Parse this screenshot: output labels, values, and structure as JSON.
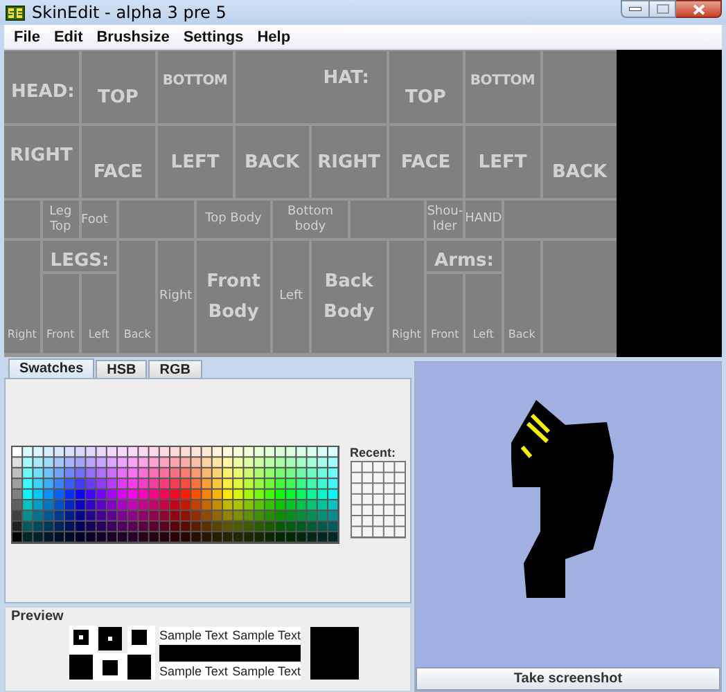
{
  "window": {
    "title": "SkinEdit - alpha 3 pre 5"
  },
  "menu": [
    "File",
    "Edit",
    "Brushsize",
    "Settings",
    "Help"
  ],
  "template": {
    "regions": [
      {
        "kind": "label",
        "label": "HEAD:"
      },
      {
        "kind": "label",
        "label": "TOP"
      },
      {
        "kind": "label",
        "label": "BOTTOM"
      },
      {
        "kind": "label",
        "label": "HAT:"
      },
      {
        "kind": "label",
        "label": "TOP"
      },
      {
        "kind": "label",
        "label": "BOTTOM"
      },
      {
        "kind": "empty"
      },
      {
        "kind": "label",
        "label": "RIGHT"
      },
      {
        "kind": "label",
        "label": "FACE"
      },
      {
        "kind": "label",
        "label": "LEFT"
      },
      {
        "kind": "label",
        "label": "BACK"
      },
      {
        "kind": "label",
        "label": "RIGHT"
      },
      {
        "kind": "label",
        "label": "FACE"
      },
      {
        "kind": "label",
        "label": "LEFT"
      },
      {
        "kind": "label",
        "label": "BACK"
      },
      {
        "kind": "empty"
      },
      {
        "kind": "label",
        "label": "Leg Top"
      },
      {
        "kind": "label",
        "label": "Foot"
      },
      {
        "kind": "empty"
      },
      {
        "kind": "label",
        "label": "Top Body"
      },
      {
        "kind": "label",
        "label": "Bottom body"
      },
      {
        "kind": "empty"
      },
      {
        "kind": "label",
        "label": "Shou-lder"
      },
      {
        "kind": "label",
        "label": "HAND"
      },
      {
        "kind": "empty"
      },
      {
        "kind": "label",
        "label": "Right"
      },
      {
        "kind": "label",
        "label": "Front"
      },
      {
        "kind": "label",
        "label": "Left"
      },
      {
        "kind": "label",
        "label": "Back"
      },
      {
        "kind": "label",
        "label": "Right"
      },
      {
        "kind": "label",
        "label": "Front Body"
      },
      {
        "kind": "label",
        "label": "Left"
      },
      {
        "kind": "label",
        "label": "Back Body"
      },
      {
        "kind": "label",
        "label": "Right"
      },
      {
        "kind": "label",
        "label": "Front"
      },
      {
        "kind": "label",
        "label": "Left"
      },
      {
        "kind": "label",
        "label": "Back"
      },
      {
        "kind": "empty"
      }
    ],
    "section_labels": [
      "LEGS:",
      "Arms:"
    ]
  },
  "color_chooser": {
    "tabs": [
      {
        "label": "Swatches",
        "selected": true
      },
      {
        "label": "HSB",
        "selected": false
      },
      {
        "label": "RGB",
        "selected": false
      }
    ],
    "recent_label": "Recent:"
  },
  "preview": {
    "title": "Preview",
    "sample_texts": [
      "Sample Text",
      "Sample Text",
      "Sample Text",
      "Sample Text"
    ]
  },
  "render_view": {
    "button": "Take screenshot"
  }
}
